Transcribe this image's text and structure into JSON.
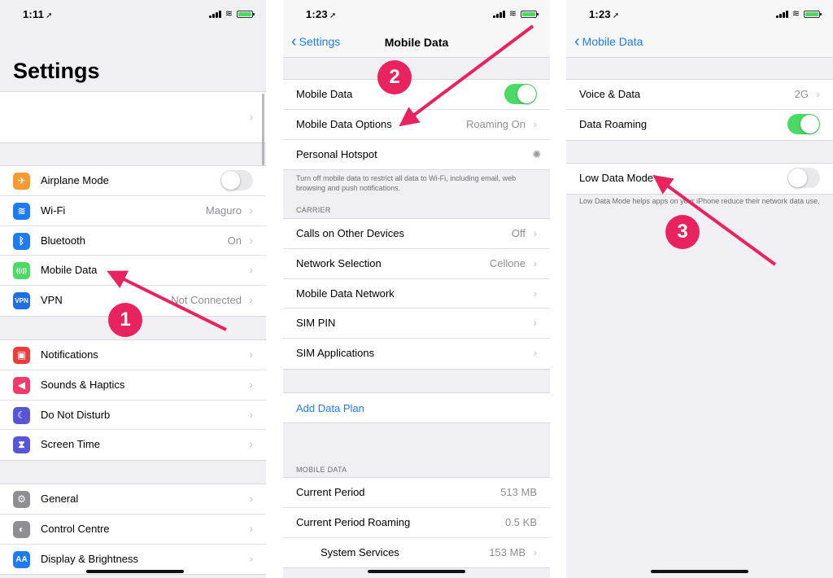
{
  "panel1": {
    "time": "1:11",
    "title": "Settings",
    "group_a": [
      {
        "label": "Airplane Mode",
        "value": "",
        "toggle": "off",
        "icon_name": "airplane-icon",
        "icon_color": "#f79a2f"
      },
      {
        "label": "Wi-Fi",
        "value": "Maguro",
        "icon_name": "wifi-icon",
        "icon_color": "#1f7cf0"
      },
      {
        "label": "Bluetooth",
        "value": "On",
        "icon_name": "bluetooth-icon",
        "icon_color": "#1f7cf0"
      },
      {
        "label": "Mobile Data",
        "value": "",
        "icon_name": "antenna-icon",
        "icon_color": "#4cd964"
      },
      {
        "label": "VPN",
        "value": "Not Connected",
        "icon_name": "vpn-icon",
        "icon_color": "#1f6fe0"
      }
    ],
    "group_b": [
      {
        "label": "Notifications",
        "icon_name": "notifications-icon",
        "icon_color": "#f03b3b"
      },
      {
        "label": "Sounds & Haptics",
        "icon_name": "speaker-icon",
        "icon_color": "#f03b6b"
      },
      {
        "label": "Do Not Disturb",
        "icon_name": "moon-icon",
        "icon_color": "#5856d6"
      },
      {
        "label": "Screen Time",
        "icon_name": "hourglass-icon",
        "icon_color": "#5856d6"
      }
    ],
    "group_c": [
      {
        "label": "General",
        "icon_name": "gear-icon",
        "icon_color": "#8e8e93"
      },
      {
        "label": "Control Centre",
        "icon_name": "switches-icon",
        "icon_color": "#8e8e93"
      },
      {
        "label": "Display & Brightness",
        "icon_name": "display-icon",
        "icon_color": "#1f7cf0"
      }
    ],
    "icon_texts": {
      "airplane": "✈",
      "wifi": "≋",
      "bluetooth": "ᛒ",
      "antenna": "((ı))",
      "vpn": "VPN",
      "notifications": "▣",
      "speaker": "◀",
      "moon": "☾",
      "hourglass": "⧗",
      "gear": "⚙",
      "switches": "◐",
      "display": "AA"
    },
    "badge": "1"
  },
  "panel2": {
    "time": "1:23",
    "back_label": "Settings",
    "title": "Mobile Data",
    "group_a": [
      {
        "label": "Mobile Data",
        "value": "",
        "toggle": "on"
      },
      {
        "label": "Mobile Data Options",
        "value": "Roaming On",
        "chevron": true
      },
      {
        "label": "Personal Hotspot",
        "value": "",
        "spinner": true
      }
    ],
    "footnote": "Turn off mobile data to restrict all data to Wi-Fi, including email, web browsing and push notifications.",
    "carrier_header": "CARRIER",
    "group_b": [
      {
        "label": "Calls on Other Devices",
        "value": "Off"
      },
      {
        "label": "Network Selection",
        "value": "Cellone"
      },
      {
        "label": "Mobile Data Network",
        "value": ""
      },
      {
        "label": "SIM PIN",
        "value": ""
      },
      {
        "label": "SIM Applications",
        "value": ""
      }
    ],
    "add_plan": "Add Data Plan",
    "mobile_data_header": "MOBILE DATA",
    "group_c": [
      {
        "label": "Current Period",
        "value": "513 MB",
        "chevron": false
      },
      {
        "label": "Current Period Roaming",
        "value": "0.5 KB",
        "chevron": false
      },
      {
        "label": "System Services",
        "value": "153 MB",
        "chevron": true
      }
    ],
    "badge": "2"
  },
  "panel3": {
    "time": "1:23",
    "back_label": "Mobile Data",
    "group_a": [
      {
        "label": "Voice & Data",
        "value": "2G",
        "chevron": true
      },
      {
        "label": "Data Roaming",
        "value": "",
        "toggle": "on"
      }
    ],
    "group_b": [
      {
        "label": "Low Data Mode",
        "value": "",
        "toggle": "off"
      }
    ],
    "footnote": "Low Data Mode helps apps on your iPhone reduce their network data use.",
    "badge": "3"
  },
  "colors": {
    "accent": "#1f7cf0",
    "toggle_on": "#4cd964",
    "annotation": "#e8235f"
  }
}
